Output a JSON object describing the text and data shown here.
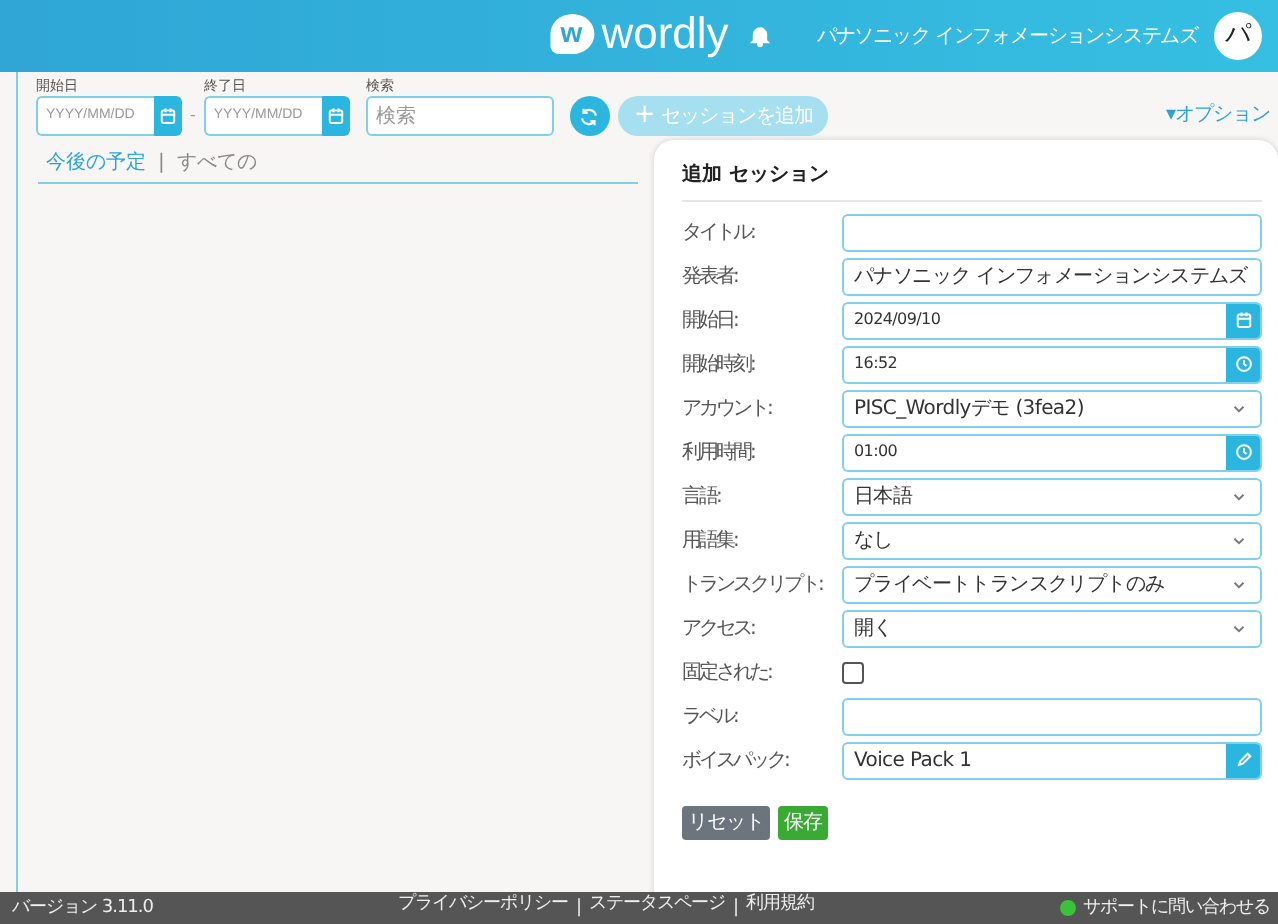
{
  "header": {
    "logo_mark": "w",
    "logo": "wordly",
    "user_name": "パナソニック インフォメーションシステムズ",
    "avatar": "パ"
  },
  "filters": {
    "start": {
      "label": "開始日",
      "placeholder": "YYYY/MM/DD"
    },
    "separator": "-",
    "end": {
      "label": "終了日",
      "placeholder": "YYYY/MM/DD"
    },
    "search": {
      "label": "検索",
      "placeholder": "検索"
    }
  },
  "add_button": {
    "icon": "+",
    "label": "セッションを追加",
    "disabled": true
  },
  "options": {
    "icon": "▾",
    "label": "オプション"
  },
  "tabs": [
    {
      "label": "今後の予定",
      "selected": true
    },
    {
      "label": "すべての",
      "selected": false
    }
  ],
  "tab_separator": "|",
  "form": {
    "title": "追加 セッション",
    "fields": [
      {
        "kind": "text",
        "label": "タイトル:"
      },
      {
        "kind": "text",
        "label": "発表者:",
        "value": "パナソニック インフォメーションシステムズ"
      },
      {
        "kind": "date",
        "label": "開始日:",
        "value": "2024/09/10"
      },
      {
        "kind": "time",
        "label": "開始時刻:",
        "value": "16:52"
      },
      {
        "kind": "select",
        "label": "アカウント:",
        "value": "PISC_Wordlyデモ (3fea2)"
      },
      {
        "kind": "time",
        "label": "利用時間:",
        "value": "01:00"
      },
      {
        "kind": "select",
        "label": "言語:",
        "value": "日本語"
      },
      {
        "kind": "select",
        "label": "用語集:",
        "value": "なし"
      },
      {
        "kind": "select",
        "label": "トランスクリプト:",
        "value": "プライベートトランスクリプトのみ"
      },
      {
        "kind": "select",
        "label": "アクセス:",
        "value": "開く"
      },
      {
        "kind": "checkbox",
        "label": "固定された:",
        "checked": false
      },
      {
        "kind": "text",
        "label": "ラベル:"
      },
      {
        "kind": "picker",
        "label": "ボイスパック:",
        "value": "Voice Pack 1"
      }
    ],
    "buttons": [
      {
        "kind": "reset",
        "label": "リセット"
      },
      {
        "kind": "save",
        "label": "保存"
      }
    ]
  },
  "footer": {
    "version": "バージョン 3.11.0",
    "items": [
      {
        "kind": "link",
        "text": "プライバシーポリシー"
      },
      {
        "kind": "separator",
        "text": "|"
      },
      {
        "kind": "link",
        "text": "ステータスページ"
      },
      {
        "kind": "separator",
        "text": "|"
      },
      {
        "kind": "link",
        "text": "利用規約"
      }
    ],
    "support": {
      "label": "サポートに問い合わせる",
      "online": true
    }
  }
}
